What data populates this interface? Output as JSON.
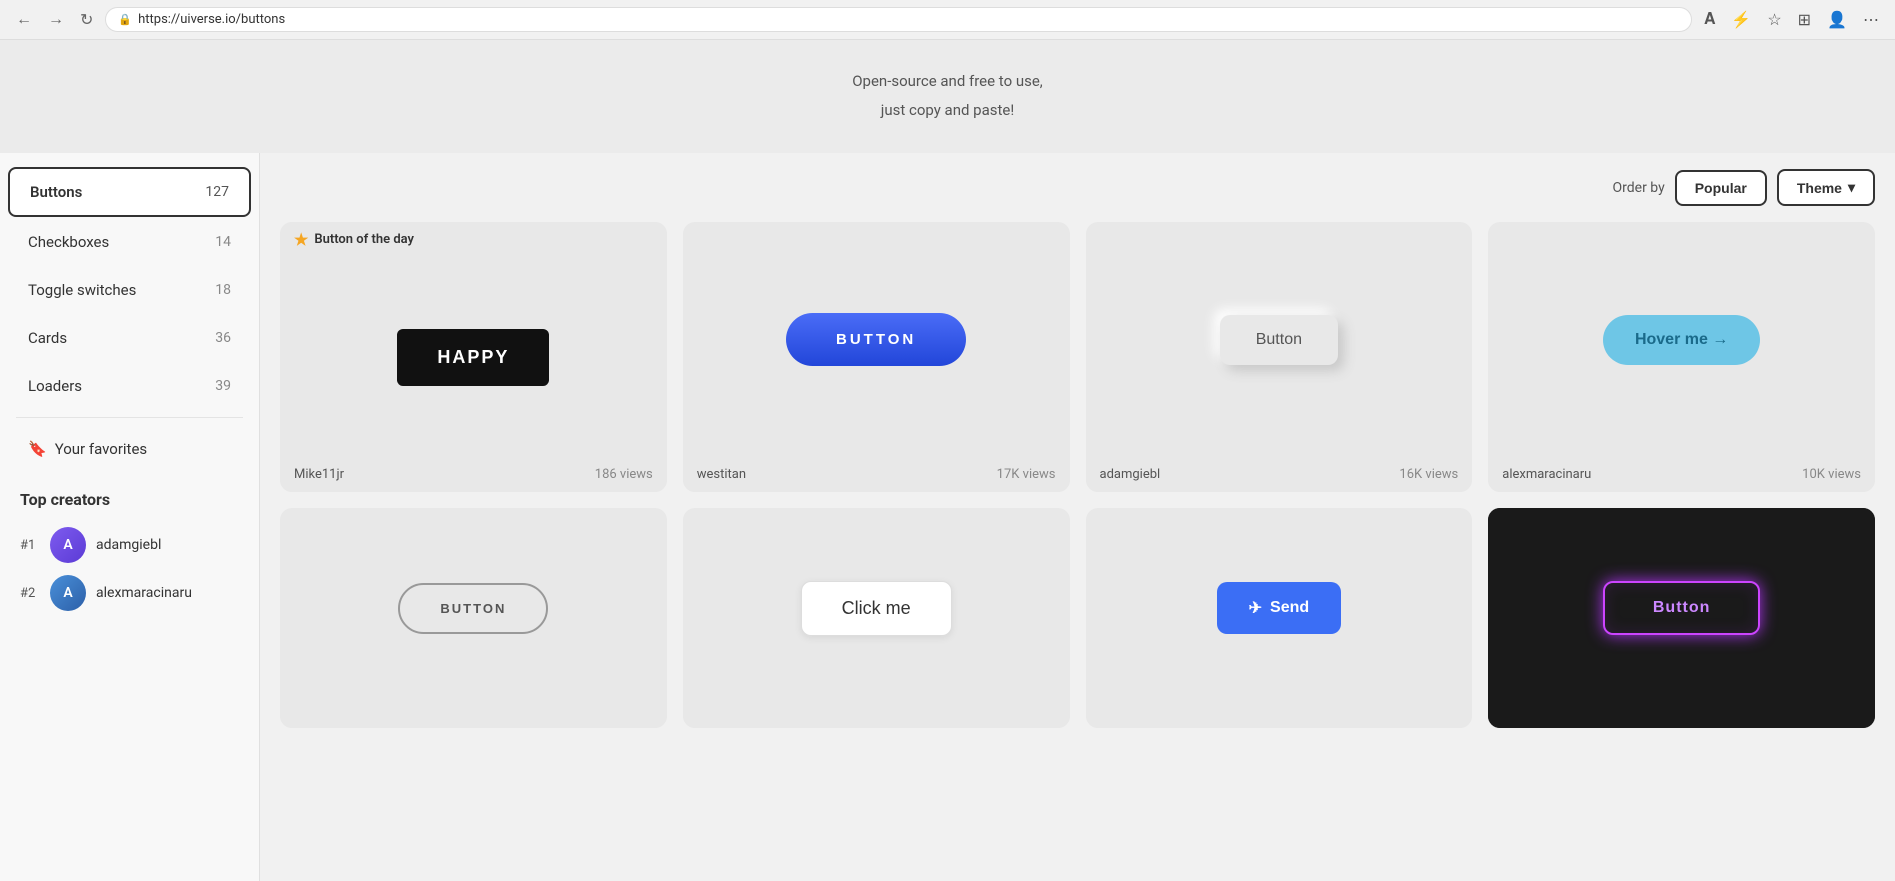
{
  "browser": {
    "url": "https://uiverse.io/buttons",
    "back_label": "←",
    "forward_label": "→",
    "refresh_label": "↻"
  },
  "hero": {
    "subtitle1": "Open-source and free to use,",
    "subtitle2": "just copy and paste!"
  },
  "order_bar": {
    "label": "Order by",
    "popular_label": "Popular",
    "theme_label": "Theme",
    "chevron": "▾"
  },
  "sidebar": {
    "items": [
      {
        "label": "Buttons",
        "count": "127",
        "active": true
      },
      {
        "label": "Checkboxes",
        "count": "14",
        "active": false
      },
      {
        "label": "Toggle switches",
        "count": "18",
        "active": false
      },
      {
        "label": "Cards",
        "count": "36",
        "active": false
      },
      {
        "label": "Loaders",
        "count": "39",
        "active": false
      }
    ],
    "favorites_label": "Your favorites",
    "favorites_icon": "🔖",
    "top_creators_title": "Top creators",
    "creators": [
      {
        "rank": "#1",
        "name": "adamgiebl",
        "color": "purple"
      },
      {
        "rank": "#2",
        "name": "alexmaracinaru",
        "color": "blue"
      }
    ]
  },
  "cards": [
    {
      "id": "card1",
      "is_botd": true,
      "botd_label": "Button of the day",
      "author": "Mike11jr",
      "views": "186 views",
      "btn_label": "HAPPY",
      "btn_type": "happy",
      "dark": false
    },
    {
      "id": "card2",
      "is_botd": false,
      "author": "westitan",
      "views": "17K views",
      "btn_label": "BUTTON",
      "btn_type": "blue",
      "dark": false
    },
    {
      "id": "card3",
      "is_botd": false,
      "author": "adamgiebl",
      "views": "16K views",
      "btn_label": "Button",
      "btn_type": "neomorphic",
      "dark": false
    },
    {
      "id": "card4",
      "is_botd": false,
      "author": "alexmaracinaru",
      "views": "10K views",
      "btn_label": "Hover me →",
      "btn_type": "hover-arrow",
      "dark": false
    },
    {
      "id": "card5",
      "is_botd": false,
      "author": "",
      "views": "",
      "btn_label": "BUTTON",
      "btn_type": "outline-rounded",
      "dark": false
    },
    {
      "id": "card6",
      "is_botd": false,
      "author": "",
      "views": "",
      "btn_label": "Click me",
      "btn_type": "click-me",
      "dark": false
    },
    {
      "id": "card7",
      "is_botd": false,
      "author": "",
      "views": "",
      "btn_label": "Send",
      "btn_type": "send",
      "dark": false
    },
    {
      "id": "card8",
      "is_botd": false,
      "author": "",
      "views": "",
      "btn_label": "Button",
      "btn_type": "neon",
      "dark": true
    }
  ]
}
